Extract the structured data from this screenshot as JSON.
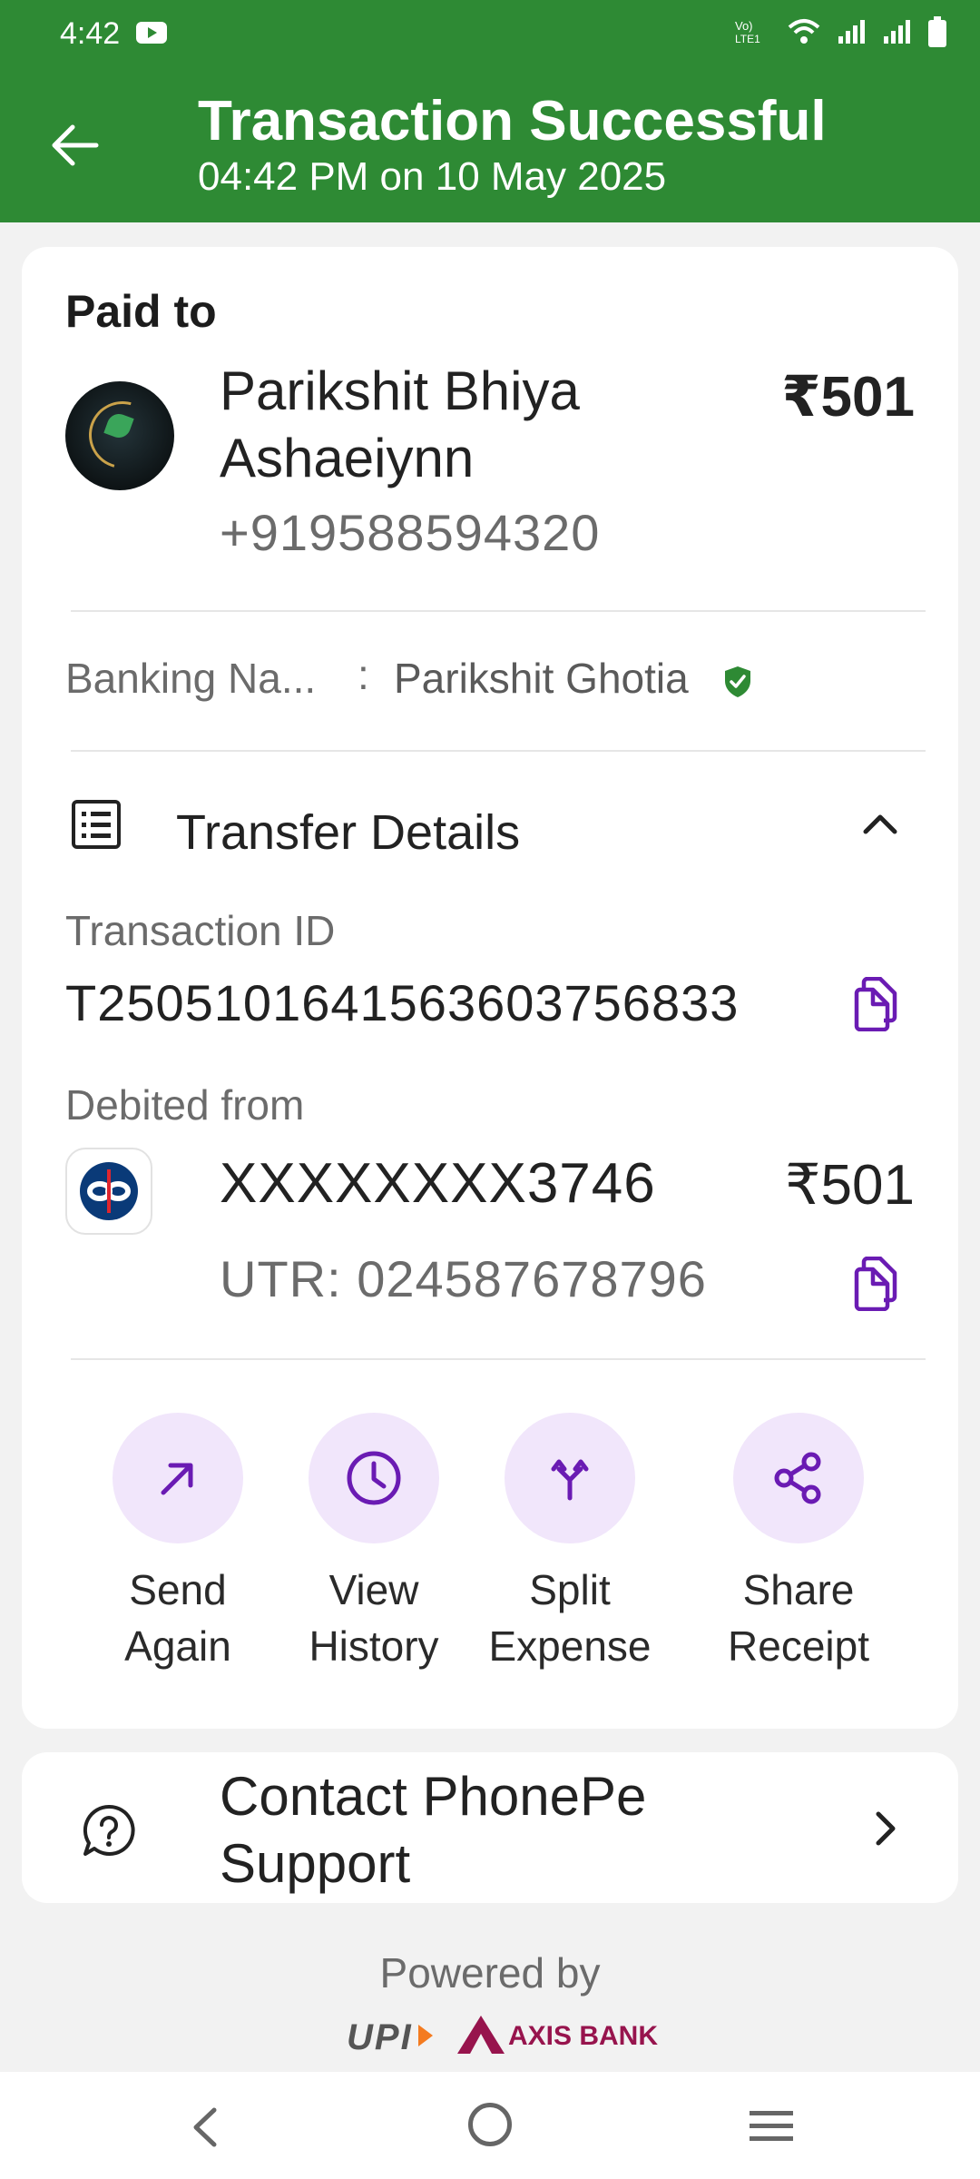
{
  "status_bar": {
    "time": "4:42"
  },
  "header": {
    "title": "Transaction Successful",
    "subtitle": "04:42 PM on 10 May 2025",
    "bg_color": "#2e8a34"
  },
  "payee": {
    "section_label": "Paid to",
    "name": "Parikshit Bhiya Ashaeiynn",
    "phone": "+919588594320",
    "amount": "₹501"
  },
  "banking": {
    "label": "Banking Na...",
    "separator": ":",
    "value": "Parikshit Ghotia"
  },
  "transfer": {
    "title": "Transfer Details",
    "txn_label": "Transaction ID",
    "txn_id": "T2505101641563603756833",
    "debited_label": "Debited from",
    "account": "XXXXXXXX3746",
    "amount": "₹501",
    "utr": "UTR: 024587678796"
  },
  "actions": [
    {
      "line1": "Send",
      "line2": "Again",
      "icon": "arrow-up-right-icon"
    },
    {
      "line1": "View",
      "line2": "History",
      "icon": "clock-icon"
    },
    {
      "line1": "Split",
      "line2": "Expense",
      "icon": "split-icon"
    },
    {
      "line1": "Share",
      "line2": "Receipt",
      "icon": "share-icon"
    }
  ],
  "support": {
    "label": "Contact PhonePe Support"
  },
  "footer": {
    "powered_by": "Powered by",
    "upi": "UPI",
    "bank": "AXIS BANK"
  },
  "colors": {
    "accent_purple": "#6a1bb3",
    "action_bg": "#f1e6fb",
    "verified_green": "#2e8a34"
  }
}
